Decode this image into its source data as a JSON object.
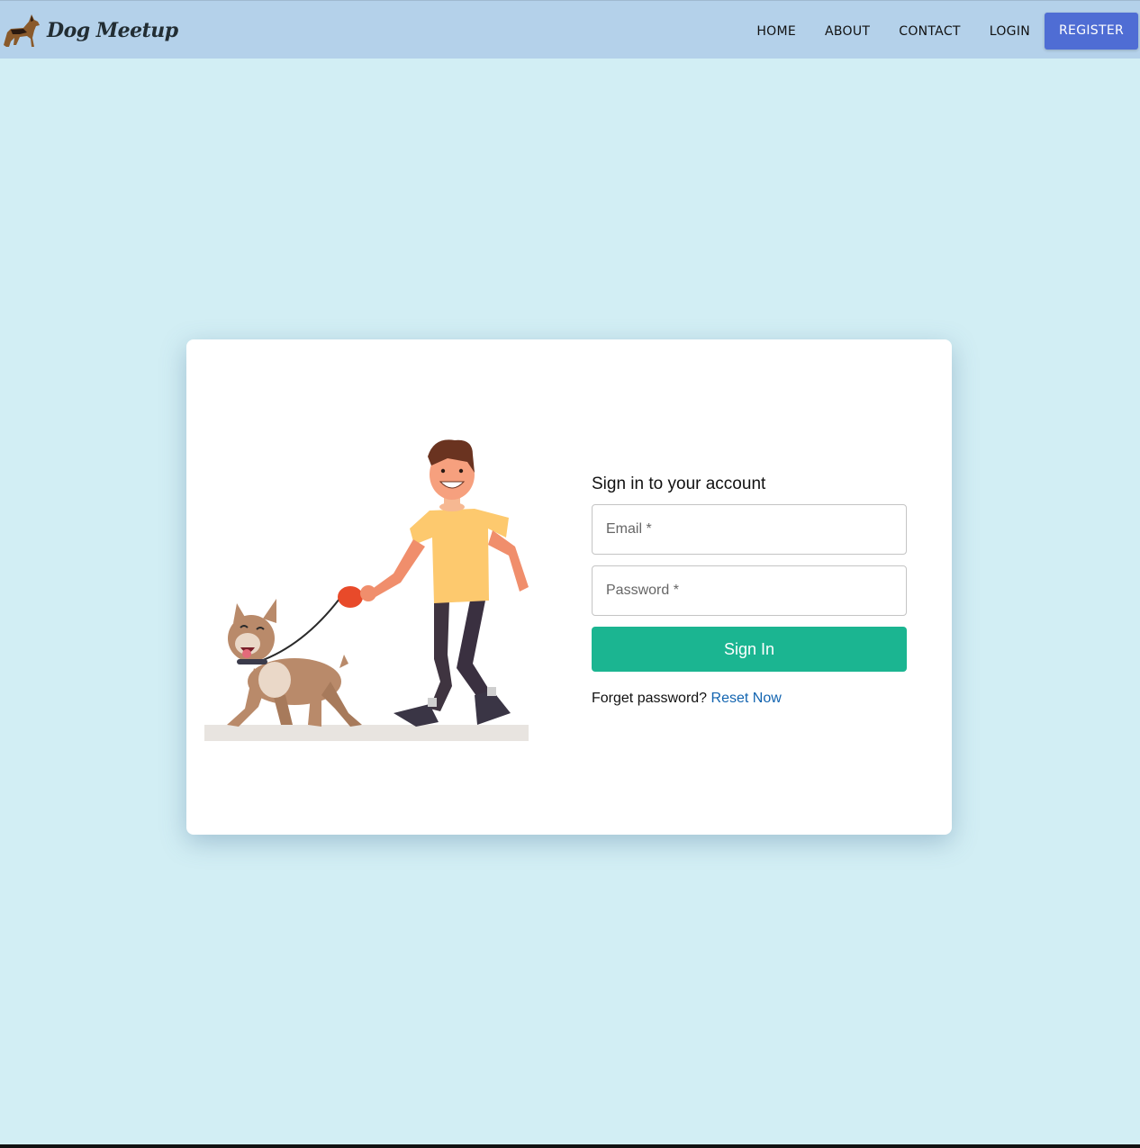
{
  "navbar": {
    "brand": "Dog Meetup",
    "links": [
      "HOME",
      "ABOUT",
      "CONTACT",
      "LOGIN"
    ],
    "register": "REGISTER"
  },
  "login": {
    "title": "Sign in to your account",
    "email_placeholder": "Email *",
    "password_placeholder": "Password *",
    "submit_label": "Sign In",
    "forgot_text": "Forget password?",
    "reset_link": "Reset Now"
  },
  "colors": {
    "page_bg": "#d2eef4",
    "navbar_bg": "#b4d1ea",
    "register_bg": "#4f6dd4",
    "signin_bg": "#1bb591",
    "link": "#1264b0"
  }
}
